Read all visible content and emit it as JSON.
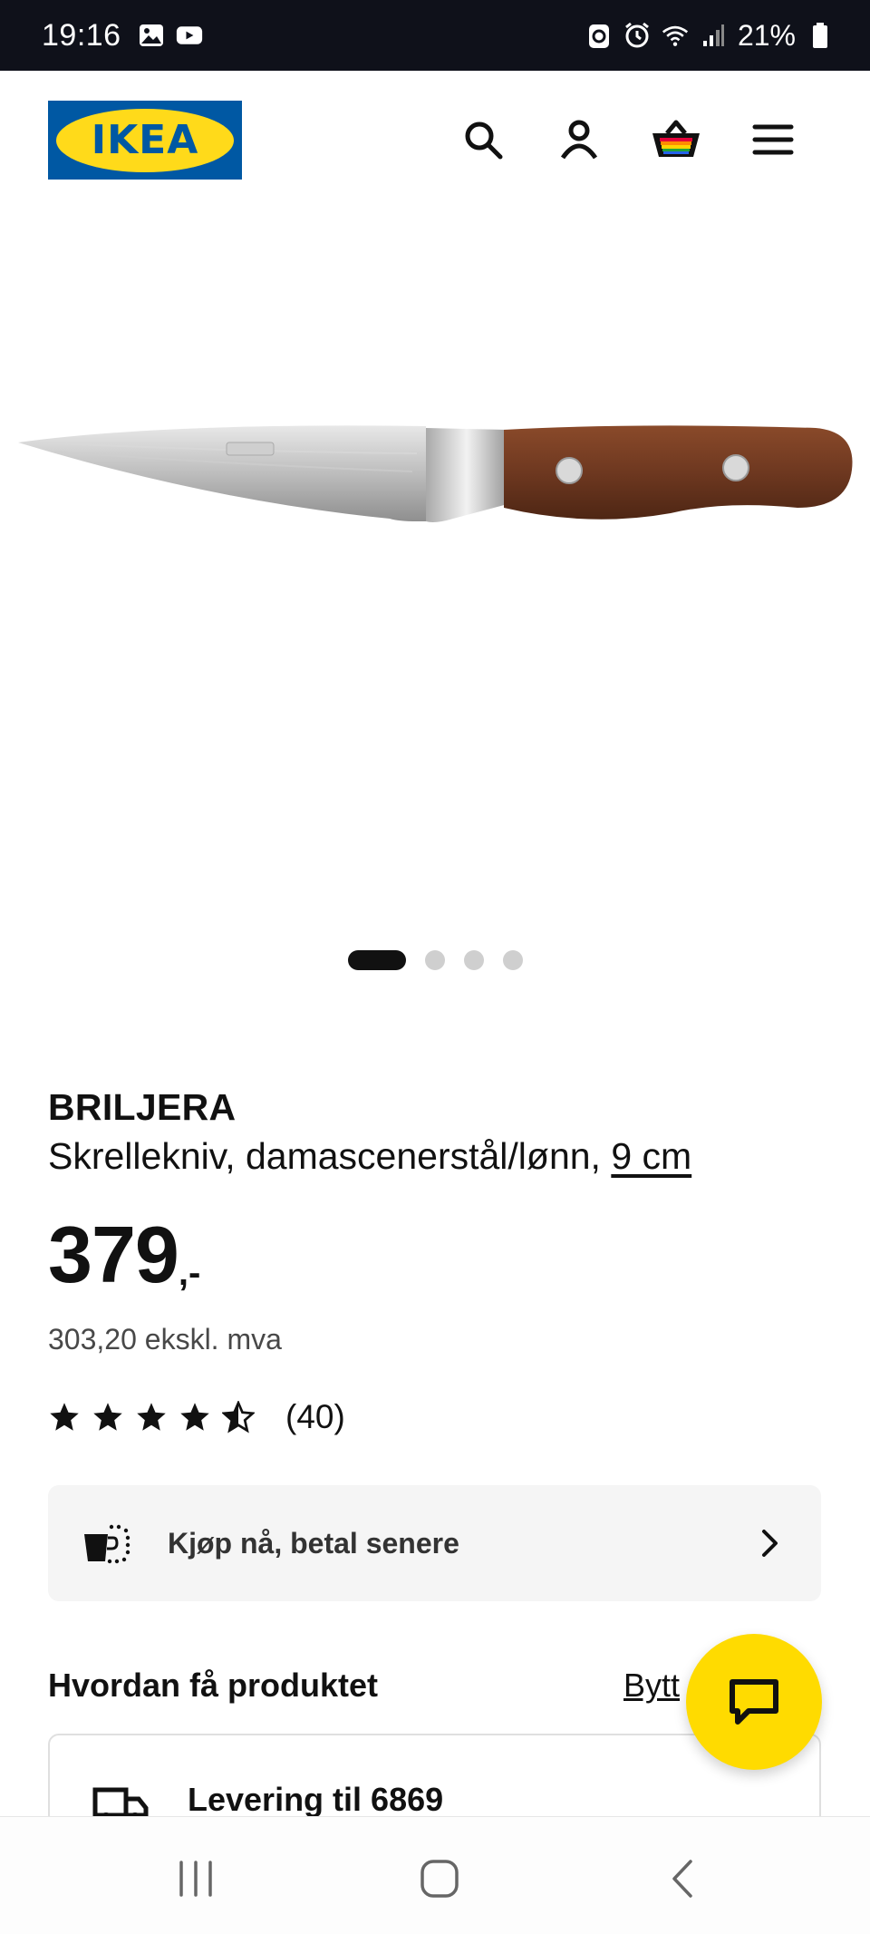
{
  "status_bar": {
    "time": "19:16",
    "battery": "21%",
    "left_icons": [
      "image-icon",
      "youtube-icon"
    ],
    "right_icons": [
      "recycle-icon",
      "alarm-icon",
      "wifi-icon",
      "signal-icon",
      "battery-icon"
    ]
  },
  "header": {
    "logo_text": "IKEA",
    "icons": [
      "search-icon",
      "account-icon",
      "basket-icon",
      "menu-icon"
    ]
  },
  "carousel": {
    "total": 4,
    "active_index": 0
  },
  "product": {
    "name": "BRILJERA",
    "description": "Skrellekniv, damascenerstål/lønn, ",
    "size_link": "9 cm",
    "price": "379",
    "price_suffix": ",-",
    "price_excl": "303,20 ekskl. mva",
    "rating_stars": 4.5,
    "rating_count": "(40)"
  },
  "pay_later": {
    "label": "Kjøp nå, betal senere"
  },
  "delivery": {
    "heading": "Hvordan få produktet",
    "change_link": "Bytt",
    "title": "Levering til 6869"
  },
  "colors": {
    "ikea_blue": "#0058a3",
    "ikea_yellow": "#ffda1a",
    "chat_fab": "#ffdb00"
  }
}
